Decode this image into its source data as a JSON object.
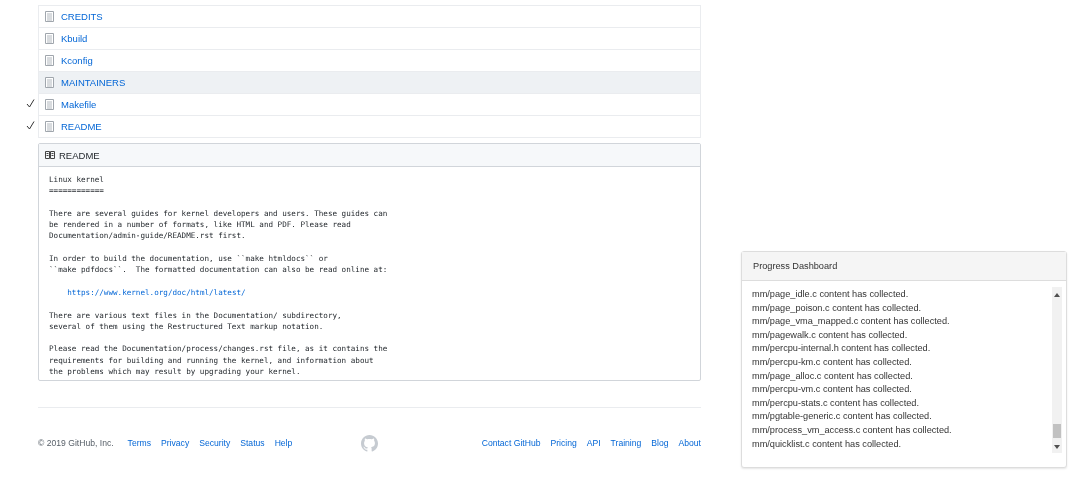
{
  "files": [
    {
      "name": "CREDITS",
      "checked": false,
      "hovered": false
    },
    {
      "name": "Kbuild",
      "checked": false,
      "hovered": false
    },
    {
      "name": "Kconfig",
      "checked": false,
      "hovered": false
    },
    {
      "name": "MAINTAINERS",
      "checked": false,
      "hovered": true
    },
    {
      "name": "Makefile",
      "checked": true,
      "hovered": false
    },
    {
      "name": "README",
      "checked": true,
      "hovered": false
    }
  ],
  "readme": {
    "title": "README",
    "lines": [
      {
        "kind": "text",
        "text": "Linux kernel"
      },
      {
        "kind": "text",
        "text": "============"
      },
      {
        "kind": "blank"
      },
      {
        "kind": "text",
        "text": "There are several guides for kernel developers and users. These guides can"
      },
      {
        "kind": "text",
        "text": "be rendered in a number of formats, like HTML and PDF. Please read"
      },
      {
        "kind": "text",
        "text": "Documentation/admin-guide/README.rst first."
      },
      {
        "kind": "blank"
      },
      {
        "kind": "text",
        "text": "In order to build the documentation, use ``make htmldocs`` or"
      },
      {
        "kind": "text",
        "text": "``make pdfdocs``.  The formatted documentation can also be read online at:"
      },
      {
        "kind": "blank"
      },
      {
        "kind": "link",
        "text": "    https://www.kernel.org/doc/html/latest/"
      },
      {
        "kind": "blank"
      },
      {
        "kind": "text",
        "text": "There are various text files in the Documentation/ subdirectory,"
      },
      {
        "kind": "text",
        "text": "several of them using the Restructured Text markup notation."
      },
      {
        "kind": "blank"
      },
      {
        "kind": "text",
        "text": "Please read the Documentation/process/changes.rst file, as it contains the"
      },
      {
        "kind": "text",
        "text": "requirements for building and running the kernel, and information about"
      },
      {
        "kind": "text",
        "text": "the problems which may result by upgrading your kernel."
      }
    ]
  },
  "footer": {
    "copyright": "© 2019 GitHub, Inc.",
    "left_links": [
      "Terms",
      "Privacy",
      "Security",
      "Status",
      "Help"
    ],
    "right_links": [
      "Contact GitHub",
      "Pricing",
      "API",
      "Training",
      "Blog",
      "About"
    ]
  },
  "dashboard": {
    "title": "Progress Dashboard",
    "log": [
      "mm/page_idle.c content has collected.",
      "mm/page_poison.c content has collected.",
      "mm/page_vma_mapped.c content has collected.",
      "mm/pagewalk.c content has collected.",
      "mm/percpu-internal.h content has collected.",
      "mm/percpu-km.c content has collected.",
      "mm/page_alloc.c content has collected.",
      "mm/percpu-vm.c content has collected.",
      "mm/percpu-stats.c content has collected.",
      "mm/pgtable-generic.c content has collected.",
      "mm/process_vm_access.c content has collected.",
      "mm/quicklist.c content has collected."
    ]
  }
}
